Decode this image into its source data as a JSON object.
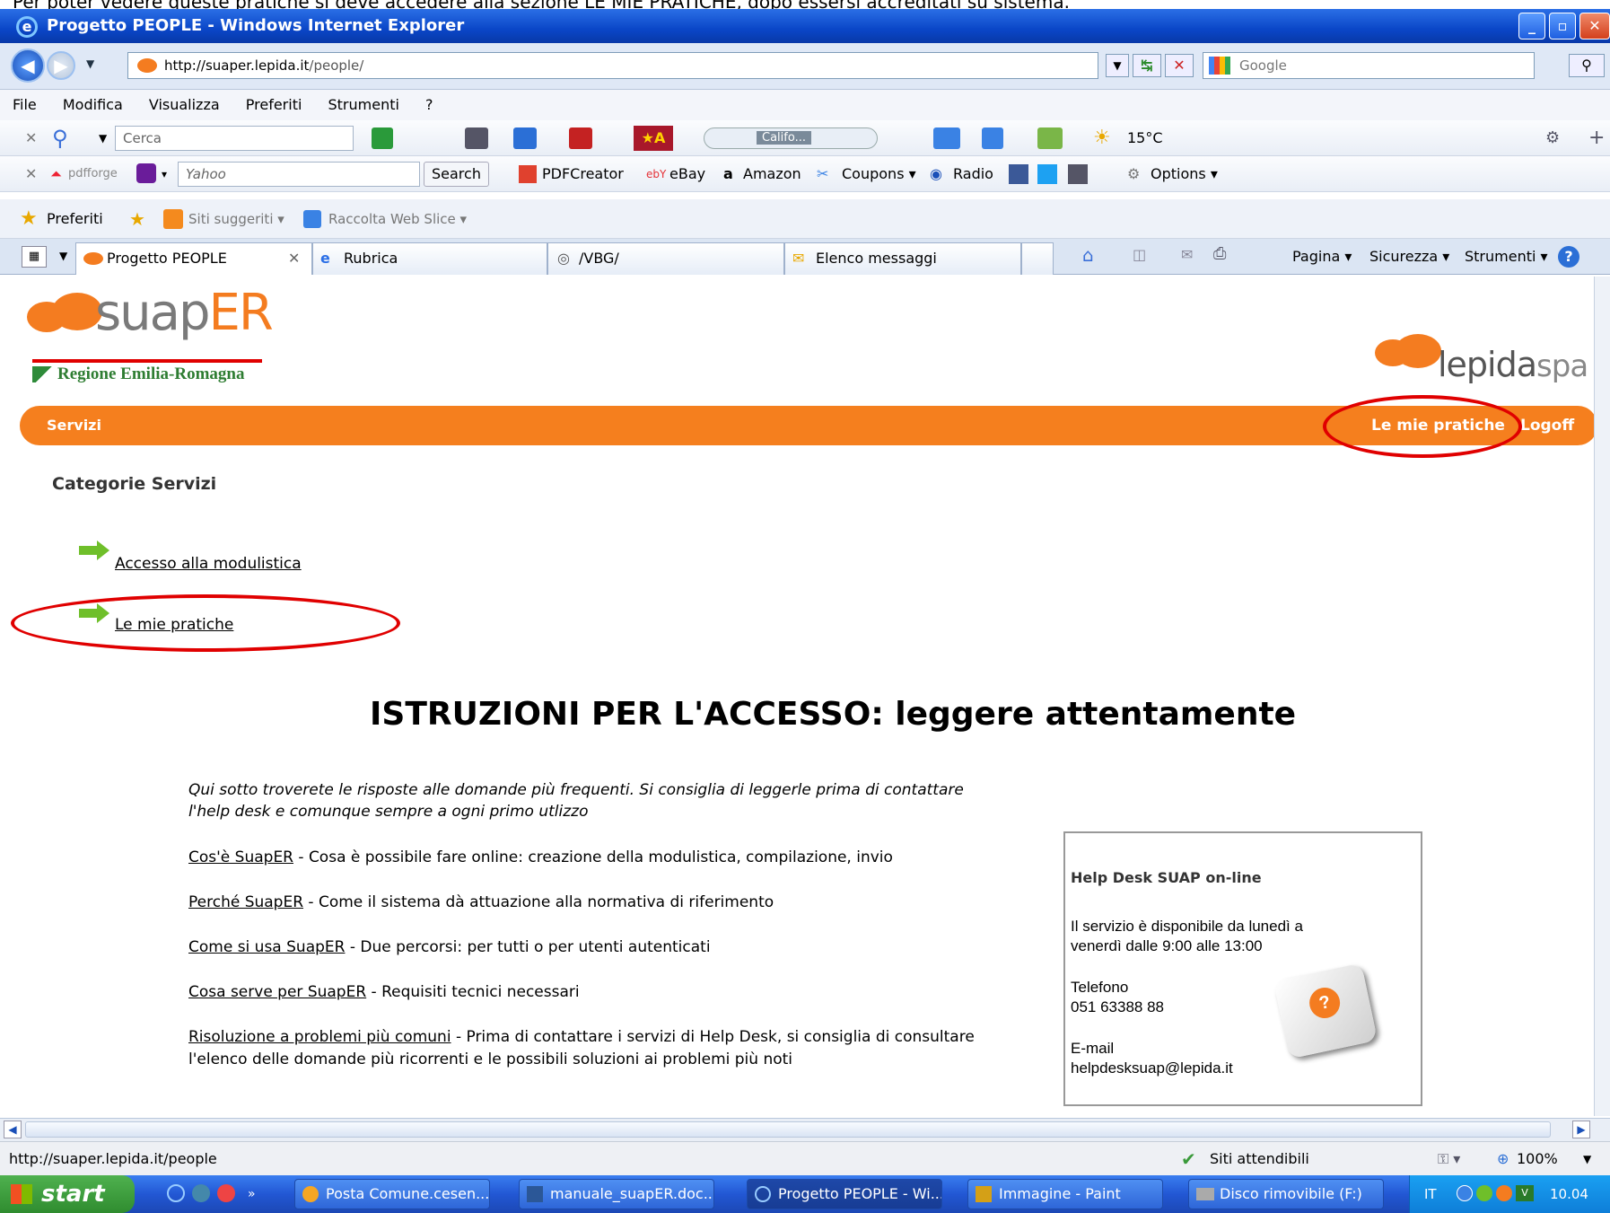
{
  "caption": "Per poter vedere queste pratiche si deve accedere alla sezione LE MIE PRATICHE, dopo essersi accreditati su sistema.",
  "window": {
    "title": "Progetto PEOPLE - Windows Internet Explorer",
    "minimize": "_",
    "maximize": "▫",
    "close": "✕"
  },
  "address": {
    "url_host": "http://suaper.lepida.it",
    "url_path": "/people/",
    "search_placeholder": "Google"
  },
  "menu": [
    "File",
    "Modifica",
    "Visualizza",
    "Preferiti",
    "Strumenti",
    "?"
  ],
  "toolbar1": {
    "search_placeholder": "Cerca",
    "weather": "15°C",
    "player": "Califo..."
  },
  "toolbar2": {
    "pdfforge": "pdfforge",
    "yahoo_placeholder": "Yahoo",
    "search_button": "Search",
    "pdfcreator": "PDFCreator",
    "ebay": "eBay",
    "amazon": "Amazon",
    "coupons": "Coupons ▾",
    "radio": "Radio",
    "options": "Options ▾"
  },
  "favorites_bar": {
    "favorites": "Preferiti",
    "suggested": "Siti suggeriti ▾",
    "webslice": "Raccolta Web Slice ▾"
  },
  "tabs": [
    {
      "label": "Progetto PEOPLE",
      "close": "✕"
    },
    {
      "label": "Rubrica"
    },
    {
      "label": "/VBG/"
    },
    {
      "label": "Elenco messaggi"
    }
  ],
  "command_bar": {
    "page": "Pagina ▾",
    "security": "Sicurezza ▾",
    "tools": "Strumenti ▾"
  },
  "site": {
    "logo_text_a": "suap",
    "logo_text_b": "ER",
    "region": "Regione Emilia-Romagna",
    "lepida_a": "lepida",
    "lepida_b": "spa",
    "nav_services": "Servizi",
    "nav_my_practices": "Le mie pratiche",
    "nav_logoff": "Logoff",
    "categories_title": "Categorie Servizi",
    "link_forms": "Accesso alla modulistica",
    "link_practices": "Le mie pratiche",
    "heading": "ISTRUZIONI PER L'ACCESSO: leggere attentamente",
    "intro_line1": "Qui sotto troverete le risposte alle domande più frequenti. Si consiglia di leggerle prima di contattare",
    "intro_line2": "l'help desk e comunque sempre a ogni primo utlizzo",
    "faq": [
      {
        "link": "Cos'è SuapER",
        "text": " - Cosa è possibile fare online: creazione della modulistica, compilazione, invio"
      },
      {
        "link": "Perché SuapER",
        "text": " - Come il sistema dà attuazione alla normativa di riferimento"
      },
      {
        "link": "Come si usa SuapER",
        "text": " - Due percorsi: per tutti o per utenti autenticati"
      },
      {
        "link": "Cosa serve per SuapER",
        "text": " - Requisiti tecnici necessari"
      },
      {
        "link": "Risoluzione a problemi più comuni",
        "text": " - Prima di contattare i servizi di Help Desk, si consiglia di consultare"
      }
    ],
    "faq_last_line2": "l'elenco delle domande più ricorrenti e le possibili soluzioni ai problemi più noti",
    "helpdesk": {
      "title": "Help Desk SUAP on-line",
      "availability_1": "Il servizio è disponibile da lunedì a",
      "availability_2": "venerdì dalle 9:00 alle 13:00",
      "phone_label": "Telefono",
      "phone": "051 63388 88",
      "email_label": "E-mail",
      "email": "helpdesksuap@lepida.it"
    }
  },
  "status": {
    "url": "http://suaper.lepida.it/people",
    "zone": "Siti attendibili",
    "zoom": "100%"
  },
  "taskbar": {
    "start": "start",
    "tasks": [
      "Posta Comune.cesen...",
      "manuale_suapER.doc...",
      "Progetto PEOPLE - Wi...",
      "Immagine - Paint",
      "Disco rimovibile (F:)"
    ],
    "lang": "IT",
    "clock": "10.04"
  },
  "colors": {
    "orange": "#f57f1e",
    "title_blue": "#0a46c7",
    "annotation_red": "#e00000"
  }
}
